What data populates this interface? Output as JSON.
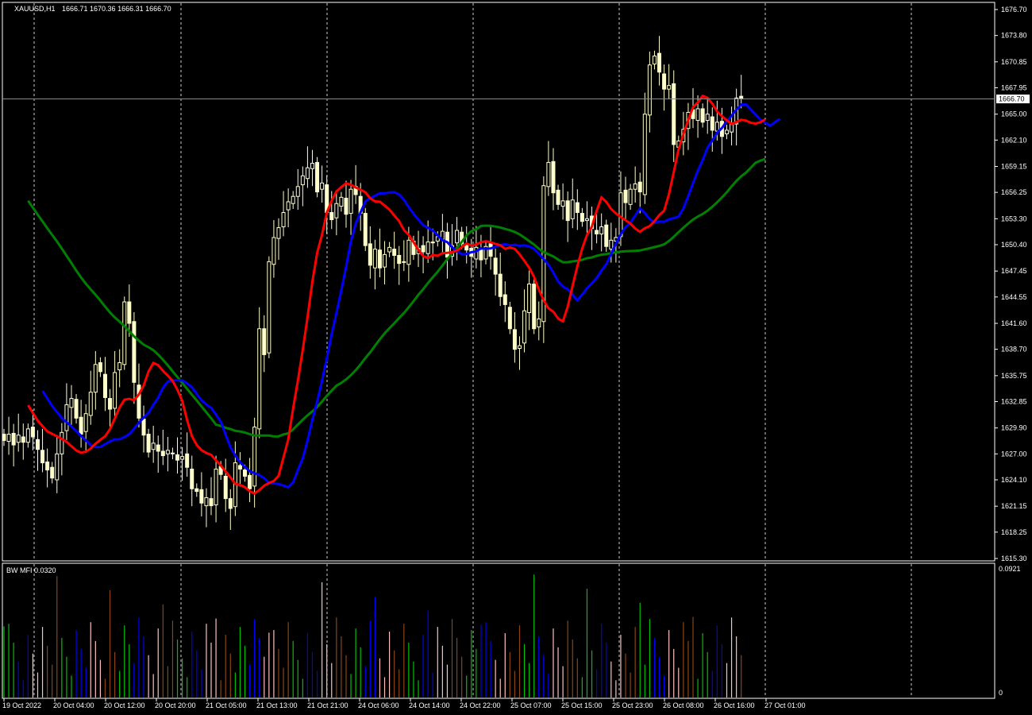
{
  "main_chart": {
    "symbol_label": "XAUUSD,H1",
    "ohlc_label": "1666.71 1670.36 1666.31 1666.70",
    "current_price_label": "1666.70",
    "current_price": 1666.7,
    "price_axis_labels": [
      "1676.70",
      "1673.80",
      "1670.85",
      "1667.95",
      "1665.00",
      "1662.10",
      "1659.15",
      "1656.25",
      "1653.30",
      "1650.40",
      "1647.45",
      "1644.55",
      "1641.60",
      "1638.70",
      "1635.75",
      "1632.85",
      "1629.90",
      "1627.00",
      "1624.10",
      "1621.15",
      "1618.25",
      "1615.30"
    ],
    "colors": {
      "background": "#000000",
      "bull_candle": "#ffffcc",
      "bear_candle": "#ffffcc",
      "ma_fast": "#ff0000",
      "ma_medium": "#0000ff",
      "ma_slow": "#008000",
      "grid": "#ffffff"
    }
  },
  "indicator": {
    "label": "BW MFI 0.0320",
    "axis_top": "0.0921",
    "axis_bottom": "0",
    "colors": {
      "green": "#00c000",
      "blue": "#0000ff",
      "pink": "#ffc0c0",
      "brown": "#8b4513"
    }
  },
  "time_axis_labels": [
    "19 Oct 2022",
    "20 Oct 04:00",
    "20 Oct 12:00",
    "20 Oct 20:00",
    "21 Oct 05:00",
    "21 Oct 13:00",
    "21 Oct 21:00",
    "24 Oct 06:00",
    "24 Oct 14:00",
    "24 Oct 22:00",
    "25 Oct 07:00",
    "25 Oct 15:00",
    "25 Oct 23:00",
    "26 Oct 08:00",
    "26 Oct 16:00",
    "27 Oct 01:00"
  ],
  "chart_data": {
    "type": "candlestick",
    "ylim": [
      1615.3,
      1676.7
    ],
    "closes": [
      1628.5,
      1629.2,
      1628.0,
      1629.1,
      1628.3,
      1629.8,
      1628.9,
      1627.5,
      1626.0,
      1625.2,
      1624.3,
      1627.0,
      1629.4,
      1632.5,
      1633.2,
      1631.0,
      1629.2,
      1631.5,
      1633.9,
      1637.0,
      1636.2,
      1633.3,
      1632.0,
      1636.1,
      1637.2,
      1644.0,
      1641.6,
      1635.0,
      1631.0,
      1629.1,
      1627.2,
      1628.2,
      1627.3,
      1626.8,
      1627.4,
      1627.0,
      1626.3,
      1626.7,
      1625.5,
      1623.1,
      1622.8,
      1621.5,
      1622.1,
      1621.2,
      1625.3,
      1624.7,
      1622.0,
      1620.9,
      1626.0,
      1625.3,
      1624.5,
      1623.1,
      1630.0,
      1641.0,
      1638.1,
      1648.5,
      1651.2,
      1652.3,
      1654.0,
      1655.2,
      1655.8,
      1656.9,
      1658.1,
      1659.0,
      1659.5,
      1656.3,
      1657.3,
      1654.0,
      1653.2,
      1655.0,
      1655.7,
      1653.8,
      1656.6,
      1656.0,
      1653.9,
      1650.3,
      1648.1,
      1649.9,
      1647.8,
      1649.3,
      1650.1,
      1649.2,
      1648.3,
      1648.5,
      1650.9,
      1649.3,
      1650.0,
      1649.6,
      1650.7,
      1650.6,
      1651.3,
      1651.9,
      1649.0,
      1650.3,
      1652.0,
      1650.5,
      1649.8,
      1649.1,
      1650.1,
      1648.7,
      1650.2,
      1649.1,
      1647.1,
      1644.6,
      1643.7,
      1641.0,
      1638.7,
      1639.1,
      1643.0,
      1646.0,
      1641.0,
      1642.1,
      1657.0,
      1659.6,
      1656.2,
      1654.9,
      1655.3,
      1653.1,
      1655.4,
      1654.0,
      1653.0,
      1653.3,
      1652.2,
      1651.6,
      1652.4,
      1650.2,
      1650.9,
      1651.2,
      1656.2,
      1655.1,
      1656.6,
      1657.2,
      1656.3,
      1665.0,
      1670.5,
      1671.5,
      1669.7,
      1667.8,
      1668.2,
      1661.6,
      1662.0,
      1663.3,
      1665.2,
      1664.5,
      1665.6,
      1664.1,
      1665.0,
      1663.2,
      1664.1,
      1662.5,
      1663.2,
      1663.9,
      1666.8,
      1666.7
    ]
  }
}
